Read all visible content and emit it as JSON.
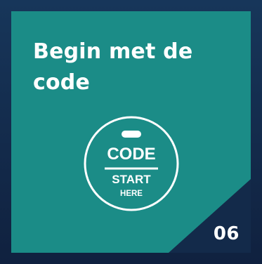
{
  "card": {
    "title": "Begin met de code",
    "number": "06"
  },
  "badge": {
    "icon": "code-start-here-icon",
    "label_top": "CODE",
    "label_mid": "START",
    "label_bottom": "HERE"
  },
  "colors": {
    "background": "#132a4a",
    "card": "#1b8c87",
    "foreground": "#ffffff"
  }
}
